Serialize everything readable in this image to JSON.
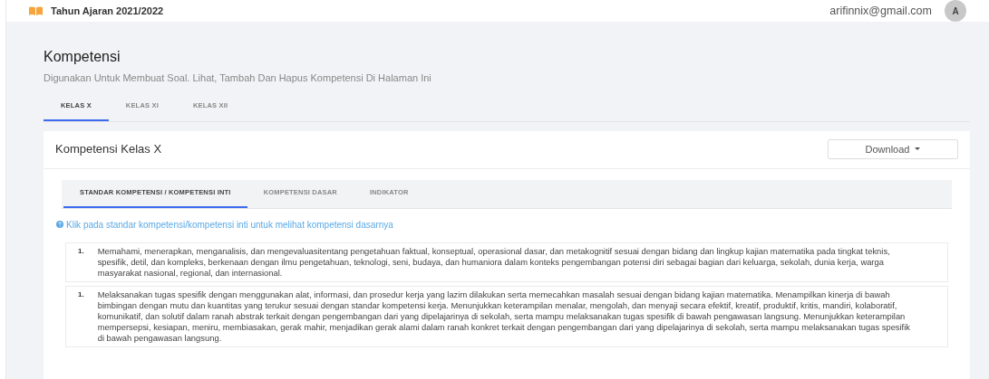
{
  "header": {
    "title": "Tahun Ajaran 2021/2022",
    "email": "arifinnix@gmail.com",
    "avatar": "A"
  },
  "page": {
    "title": "Kompetensi",
    "subtitle": "Digunakan Untuk Membuat Soal. Lihat, Tambah Dan Hapus Kompetensi Di Halaman Ini"
  },
  "class_tabs": [
    {
      "label": "KELAS X",
      "selected": true
    },
    {
      "label": "KELAS XI",
      "selected": false
    },
    {
      "label": "KELAS XII",
      "selected": false
    }
  ],
  "card": {
    "title": "Kompetensi Kelas X",
    "download_button": "Download"
  },
  "competency_tabs": [
    {
      "label": "STANDAR KOMPETENSI / KOMPETENSI INTI",
      "selected": true
    },
    {
      "label": "KOMPETENSI DASAR",
      "selected": false
    },
    {
      "label": "INDIKATOR",
      "selected": false
    }
  ],
  "hint": "Klik pada standar kompetensi/kompetensi inti untuk melihat kompetensi dasarnya",
  "items": [
    {
      "number": "1.",
      "text": "Memahami, menerapkan, menganalisis, dan mengevaluasitentang pengetahuan faktual, konseptual, operasional dasar, dan metakognitif sesuai dengan bidang dan lingkup kajian matematika pada tingkat teknis, spesifik, detil, dan kompleks, berkenaan dengan ilmu pengetahuan, teknologi, seni, budaya, dan humaniora dalam konteks pengembangan potensi diri sebagai bagian dari keluarga, sekolah, dunia kerja, warga masyarakat nasional, regional, dan internasional."
    },
    {
      "number": "1.",
      "text": "Melaksanakan tugas spesifik dengan menggunakan alat, informasi, dan prosedur kerja yang lazim dilakukan serta memecahkan masalah sesuai dengan bidang kajian matematika. Menampilkan kinerja di bawah bimbingan dengan mutu dan kuantitas yang terukur sesuai dengan standar kompetensi kerja. Menunjukkan keterampilan menalar, mengolah, dan menyaji secara efektif, kreatif, produktif, kritis, mandiri, kolaboratif, komunikatif, dan solutif dalam ranah abstrak terkait dengan pengembangan dari yang dipelajarinya di sekolah, serta mampu melaksanakan tugas spesifik di bawah pengawasan langsung. Menunjukkan keterampilan mempersepsi, kesiapan, meniru, membiasakan, gerak mahir, menjadikan gerak alami dalam ranah konkret terkait dengan pengembangan dari yang dipelajarinya di sekolah, serta mampu melaksanakan tugas spesifik di bawah pengawasan langsung."
    }
  ]
}
